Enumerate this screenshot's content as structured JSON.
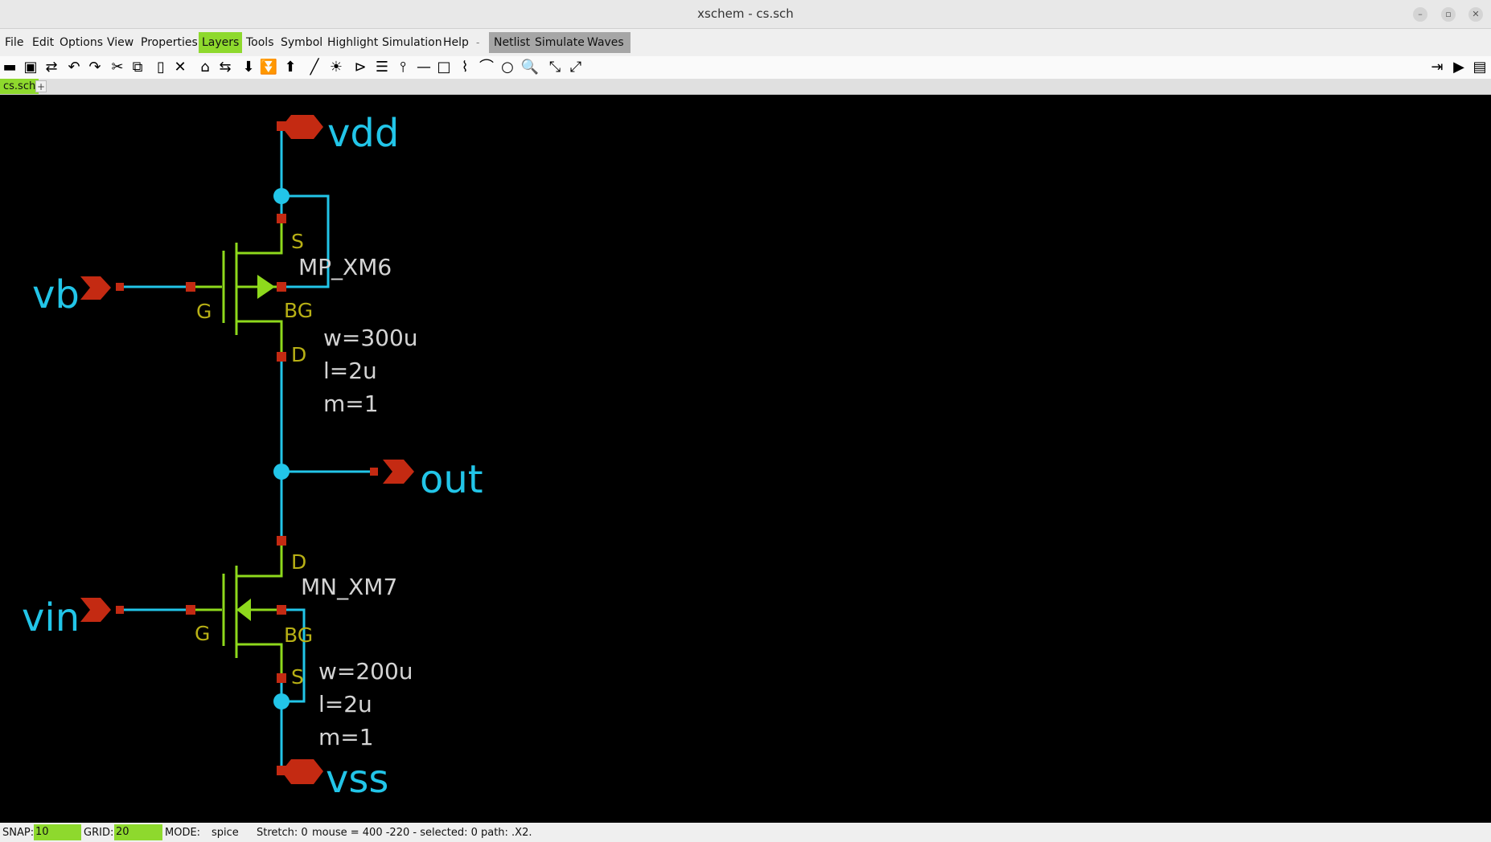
{
  "window": {
    "title": "xschem - cs.sch"
  },
  "menu": {
    "items": [
      "File",
      "Edit",
      "Options",
      "View",
      "Properties",
      "Layers",
      "Tools",
      "Symbol",
      "Highlight",
      "Simulation",
      "Help"
    ],
    "separator": "-",
    "sim_items": [
      "Netlist",
      "Simulate",
      "Waves"
    ]
  },
  "toolbar_icons": [
    "open-icon",
    "save-icon",
    "reload-icon",
    "undo-icon",
    "redo-icon",
    "cut-icon",
    "copy-icon",
    "paste-icon",
    "delete-icon",
    "descend-icon",
    "move-icon",
    "push-icon",
    "push-sym-icon",
    "pop-icon",
    "wire-icon",
    "highlight-icon",
    "pin-icon",
    "list-icon",
    "net-icon",
    "line-icon",
    "rect-icon",
    "polygon-icon",
    "arc-icon",
    "circle-icon",
    "zoom-icon",
    "zoom-in-icon",
    "zoom-out-icon",
    "netlist-icon",
    "play-icon",
    "waves-icon"
  ],
  "tabs": {
    "current": "cs.sch",
    "add": "+"
  },
  "schematic": {
    "pins": {
      "vdd": "vdd",
      "vb": "vb",
      "out": "out",
      "vin": "vin",
      "vss": "vss"
    },
    "pmos": {
      "name": "MP_XM6",
      "S": "S",
      "G": "G",
      "D": "D",
      "BG": "BG",
      "w": "w=300u",
      "l": "l=2u",
      "m": "m=1"
    },
    "nmos": {
      "name": "MN_XM7",
      "S": "S",
      "G": "G",
      "D": "D",
      "BG": "BG",
      "w": "w=200u",
      "l": "l=2u",
      "m": "m=1"
    },
    "colors": {
      "wire": "#22c5e8",
      "device": "#8ed91c",
      "pin": "#c42a12",
      "pin_label": "#22c5e8",
      "terminal": "#b8b015",
      "attr": "#d4d4d4"
    }
  },
  "status": {
    "snap_label": "SNAP:",
    "snap_value": "10",
    "grid_label": "GRID:",
    "grid_value": "20",
    "mode_label": "MODE:",
    "mode_value": "spice",
    "stretch": "Stretch: 0",
    "mouse": "mouse = 400 -220 - selected: 0 path: .X2."
  }
}
